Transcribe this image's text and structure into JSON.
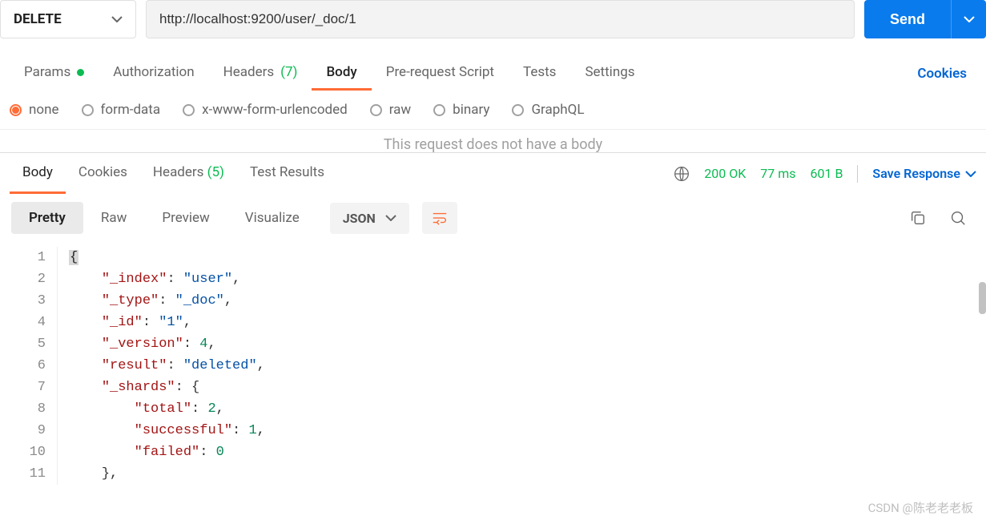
{
  "request": {
    "method": "DELETE",
    "url": "http://localhost:9200/user/_doc/1",
    "send_label": "Send"
  },
  "request_tabs": {
    "params": "Params",
    "authorization": "Authorization",
    "headers_label": "Headers",
    "headers_count": "(7)",
    "body": "Body",
    "prescript": "Pre-request Script",
    "tests": "Tests",
    "settings": "Settings",
    "cookies": "Cookies",
    "active": "Body"
  },
  "body_types": {
    "none": "none",
    "form_data": "form-data",
    "urlencoded": "x-www-form-urlencoded",
    "raw": "raw",
    "binary": "binary",
    "graphql": "GraphQL",
    "selected": "none",
    "empty_msg": "This request does not have a body"
  },
  "response_tabs": {
    "body": "Body",
    "cookies": "Cookies",
    "headers_label": "Headers",
    "headers_count": "(5)",
    "test_results": "Test Results",
    "active": "Body"
  },
  "response_meta": {
    "status": "200 OK",
    "time": "77 ms",
    "size": "601 B",
    "save": "Save Response"
  },
  "view_tabs": {
    "pretty": "Pretty",
    "raw": "Raw",
    "preview": "Preview",
    "visualize": "Visualize",
    "format": "JSON",
    "active": "Pretty"
  },
  "response_body": {
    "_index": "user",
    "_type": "_doc",
    "_id": "1",
    "_version": 4,
    "result": "deleted",
    "_shards": {
      "total": 2,
      "successful": 1,
      "failed": 0
    }
  },
  "code_lines": [
    {
      "n": 1,
      "indent": 0,
      "tokens": [
        {
          "t": "brace-hl",
          "v": "{"
        }
      ]
    },
    {
      "n": 2,
      "indent": 1,
      "tokens": [
        {
          "t": "key",
          "v": "\"_index\""
        },
        {
          "t": "pun",
          "v": ": "
        },
        {
          "t": "str",
          "v": "\"user\""
        },
        {
          "t": "pun",
          "v": ","
        }
      ]
    },
    {
      "n": 3,
      "indent": 1,
      "tokens": [
        {
          "t": "key",
          "v": "\"_type\""
        },
        {
          "t": "pun",
          "v": ": "
        },
        {
          "t": "str",
          "v": "\"_doc\""
        },
        {
          "t": "pun",
          "v": ","
        }
      ]
    },
    {
      "n": 4,
      "indent": 1,
      "tokens": [
        {
          "t": "key",
          "v": "\"_id\""
        },
        {
          "t": "pun",
          "v": ": "
        },
        {
          "t": "str",
          "v": "\"1\""
        },
        {
          "t": "pun",
          "v": ","
        }
      ]
    },
    {
      "n": 5,
      "indent": 1,
      "tokens": [
        {
          "t": "key",
          "v": "\"_version\""
        },
        {
          "t": "pun",
          "v": ": "
        },
        {
          "t": "num",
          "v": "4"
        },
        {
          "t": "pun",
          "v": ","
        }
      ]
    },
    {
      "n": 6,
      "indent": 1,
      "tokens": [
        {
          "t": "key",
          "v": "\"result\""
        },
        {
          "t": "pun",
          "v": ": "
        },
        {
          "t": "str",
          "v": "\"deleted\""
        },
        {
          "t": "pun",
          "v": ","
        }
      ]
    },
    {
      "n": 7,
      "indent": 1,
      "tokens": [
        {
          "t": "key",
          "v": "\"_shards\""
        },
        {
          "t": "pun",
          "v": ": {"
        }
      ]
    },
    {
      "n": 8,
      "indent": 2,
      "tokens": [
        {
          "t": "key",
          "v": "\"total\""
        },
        {
          "t": "pun",
          "v": ": "
        },
        {
          "t": "num",
          "v": "2"
        },
        {
          "t": "pun",
          "v": ","
        }
      ]
    },
    {
      "n": 9,
      "indent": 2,
      "tokens": [
        {
          "t": "key",
          "v": "\"successful\""
        },
        {
          "t": "pun",
          "v": ": "
        },
        {
          "t": "num",
          "v": "1"
        },
        {
          "t": "pun",
          "v": ","
        }
      ]
    },
    {
      "n": 10,
      "indent": 2,
      "tokens": [
        {
          "t": "key",
          "v": "\"failed\""
        },
        {
          "t": "pun",
          "v": ": "
        },
        {
          "t": "num",
          "v": "0"
        }
      ]
    },
    {
      "n": 11,
      "indent": 1,
      "tokens": [
        {
          "t": "pun",
          "v": "},"
        }
      ]
    }
  ],
  "watermark": "CSDN @陈老老老板"
}
